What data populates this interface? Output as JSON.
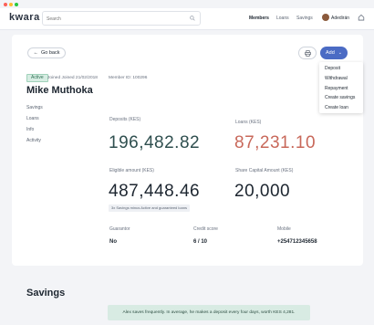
{
  "app": {
    "logo": "kwara"
  },
  "colors": {
    "accent": "#4b6bc4",
    "deposits": "#2f4f4f",
    "loans": "#c8685a",
    "active_badge": "#d7ede3",
    "insight_bg": "#d8ebe3"
  },
  "search": {
    "placeholder": "Search",
    "value": ""
  },
  "nav": {
    "members": "Members",
    "loans": "Loans",
    "savings": "Savings",
    "user": "Adedirán"
  },
  "actions": {
    "back": "Go back",
    "add": "Add"
  },
  "add_menu": [
    "Deposit",
    "Withdrawal",
    "Repayment",
    "Create savings",
    "Create loan"
  ],
  "member": {
    "status": "Active",
    "joined": "Joined Joined 21/02/2018",
    "member_id": "Member ID: 100296",
    "name": "Mike Muthoka"
  },
  "side_nav": [
    "Savings",
    "Loans",
    "Info",
    "Activity"
  ],
  "stats": {
    "deposits_label": "Deposits (KES)",
    "deposits_value": "196,482.82",
    "loans_label": "Loans (KES)",
    "loans_value": "87,231.10",
    "eligible_label": "Eligible amount (KES)",
    "eligible_value": "487,448.46",
    "eligible_note": "3x Savings minus Active and guaranteed loans",
    "share_label": "Share Capital Amount (KES)",
    "share_value": "20,000"
  },
  "details": {
    "guarantor_label": "Guarantor",
    "guarantor_value": "No",
    "credit_label": "Credit score",
    "credit_value": "6 / 10",
    "mobile_label": "Mobile",
    "mobile_value": "+254712345658"
  },
  "savings": {
    "title": "Savings",
    "insight": "Alex saves frequently. In average, he makes a deposit every four days, worth KES 4,281."
  }
}
